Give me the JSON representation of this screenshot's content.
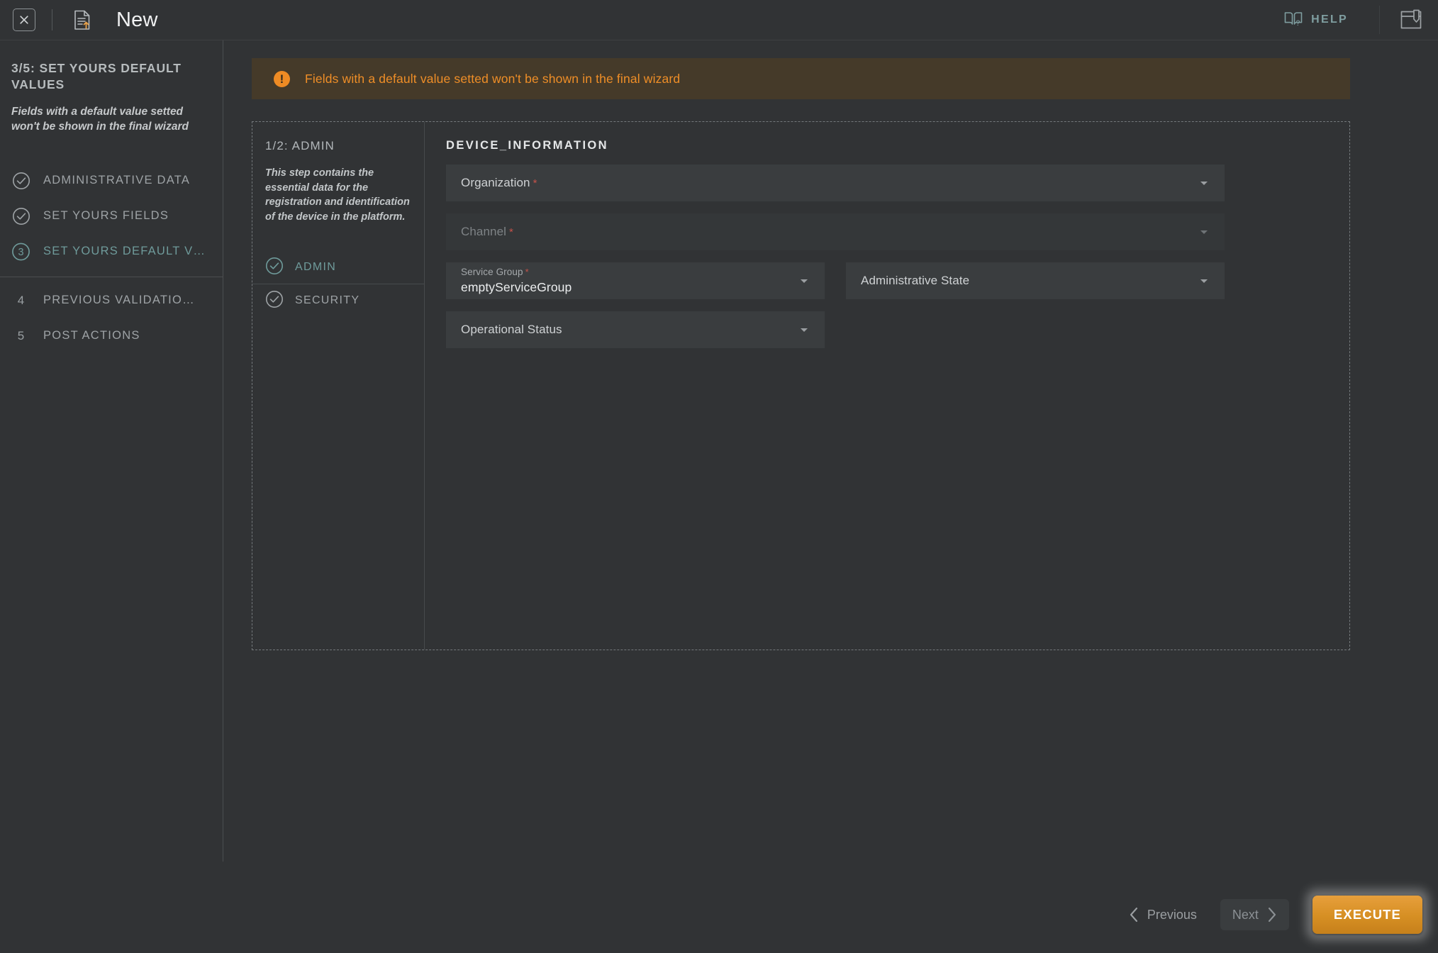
{
  "topbar": {
    "close_icon": "close-box-icon",
    "doc_icon": "document-upload-icon",
    "title": "New",
    "help_icon": "book-question-icon",
    "help_label": "HELP",
    "save_icon": "save-import-icon"
  },
  "sidebar": {
    "title": "3/5: SET YOURS DEFAULT VALUES",
    "description": "Fields with a default value setted won't be shown in the final wizard",
    "steps": [
      {
        "marker": "check",
        "number": "",
        "label": "ADMINISTRATIVE DATA",
        "state": "done"
      },
      {
        "marker": "check",
        "number": "",
        "label": "SET YOURS FIELDS",
        "state": "done"
      },
      {
        "marker": "number",
        "number": "3",
        "label": "SET YOURS DEFAULT V…",
        "state": "active"
      },
      {
        "marker": "plain",
        "number": "4",
        "label": "PREVIOUS VALIDATIO…",
        "state": "pending"
      },
      {
        "marker": "plain",
        "number": "5",
        "label": "POST ACTIONS",
        "state": "pending"
      }
    ]
  },
  "warning": {
    "icon": "exclamation-circle-icon",
    "glyph": "!",
    "message": "Fields with a default value setted won't be shown in the final wizard",
    "bg_color": "#453a29",
    "text_color": "#ef8e27"
  },
  "panel": {
    "left": {
      "title": "1/2: ADMIN",
      "description": "This step contains the essential data for the registration and identification of the device in the platform.",
      "items": [
        {
          "label": "ADMIN",
          "icon": "check-circle-icon",
          "state": "active"
        },
        {
          "label": "SECURITY",
          "icon": "check-circle-icon",
          "state": "default"
        }
      ]
    },
    "right": {
      "section_title": "DEVICE_INFORMATION",
      "rows": [
        {
          "fields": [
            {
              "name": "organization",
              "placeholder": "Organization",
              "required": true,
              "value": "",
              "width": "full",
              "disabled": false,
              "caret": true
            }
          ]
        },
        {
          "fields": [
            {
              "name": "channel",
              "placeholder": "Channel",
              "required": true,
              "value": "",
              "width": "full",
              "disabled": true,
              "caret": true
            }
          ]
        },
        {
          "fields": [
            {
              "name": "service-group",
              "placeholder": "Service Group",
              "required": true,
              "value": "emptyServiceGroup",
              "width": "half",
              "disabled": false,
              "caret": true
            },
            {
              "name": "administrative-state",
              "placeholder": "Administrative State",
              "required": false,
              "value": "",
              "width": "half",
              "disabled": false,
              "caret": true
            }
          ]
        },
        {
          "fields": [
            {
              "name": "operational-status",
              "placeholder": "Operational Status",
              "required": false,
              "value": "",
              "width": "half",
              "disabled": false,
              "caret": true
            }
          ]
        }
      ]
    }
  },
  "footer": {
    "previous_label": "Previous",
    "next_label": "Next",
    "execute_label": "EXECUTE",
    "execute_color": "#d68f23"
  }
}
